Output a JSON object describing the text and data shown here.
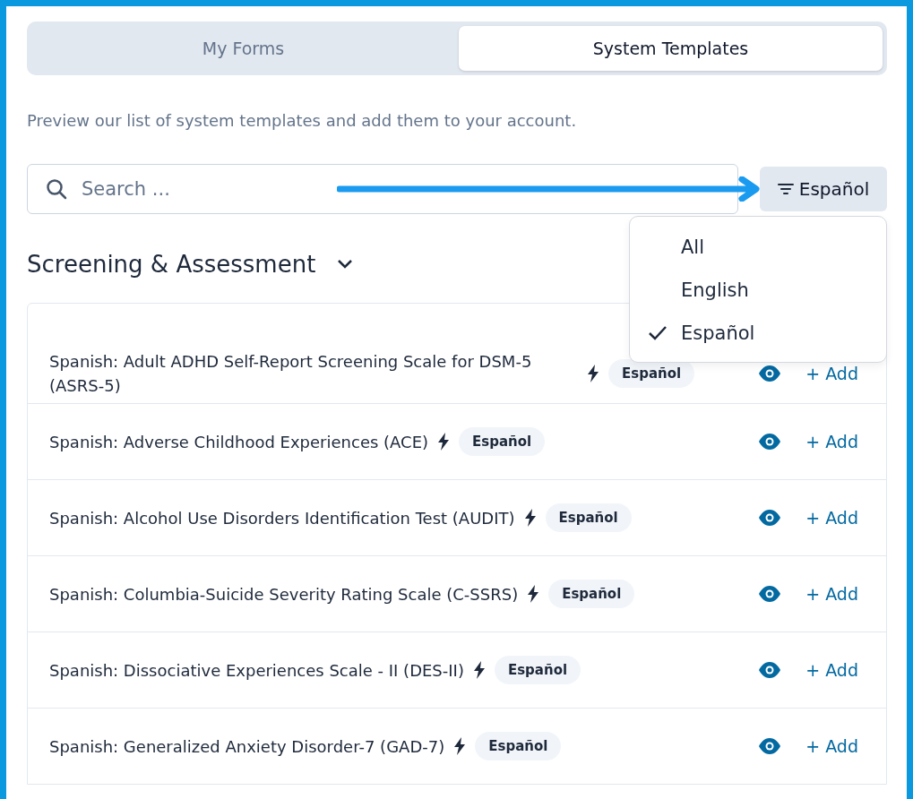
{
  "tabs": [
    {
      "label": "My Forms",
      "selected": false
    },
    {
      "label": "System Templates",
      "selected": true
    }
  ],
  "description": "Preview our list of system templates and add them to your account.",
  "search": {
    "placeholder": "Search ..."
  },
  "filter_button": {
    "label": "Español"
  },
  "filter_menu": {
    "open": true,
    "items": [
      {
        "label": "All",
        "selected": false
      },
      {
        "label": "English",
        "selected": false
      },
      {
        "label": "Español",
        "selected": true
      }
    ]
  },
  "section": {
    "title": "Screening & Assessment",
    "expanded": true,
    "rows": [
      {
        "title": "Spanish: Adult ADHD Self-Report Screening Scale for DSM-5 (ASRS-5)",
        "badge": "Español",
        "action": "+ Add"
      },
      {
        "title": "Spanish: Adverse Childhood Experiences (ACE)",
        "badge": "Español",
        "action": "+ Add"
      },
      {
        "title": "Spanish: Alcohol Use Disorders Identification Test (AUDIT)",
        "badge": "Español",
        "action": "+ Add"
      },
      {
        "title": "Spanish: Columbia-Suicide Severity Rating Scale (C-SSRS)",
        "badge": "Español",
        "action": "+ Add"
      },
      {
        "title": "Spanish: Dissociative Experiences Scale - II (DES-II)",
        "badge": "Español",
        "action": "+ Add"
      },
      {
        "title": "Spanish: Generalized Anxiety Disorder-7 (GAD-7)",
        "badge": "Español",
        "action": "+ Add"
      }
    ]
  }
}
